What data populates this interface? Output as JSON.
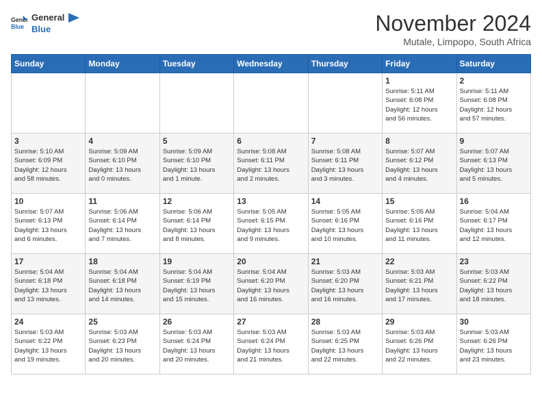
{
  "header": {
    "logo_general": "General",
    "logo_blue": "Blue",
    "month_title": "November 2024",
    "location": "Mutale, Limpopo, South Africa"
  },
  "days_of_week": [
    "Sunday",
    "Monday",
    "Tuesday",
    "Wednesday",
    "Thursday",
    "Friday",
    "Saturday"
  ],
  "weeks": [
    {
      "days": [
        {
          "number": "",
          "info": ""
        },
        {
          "number": "",
          "info": ""
        },
        {
          "number": "",
          "info": ""
        },
        {
          "number": "",
          "info": ""
        },
        {
          "number": "",
          "info": ""
        },
        {
          "number": "1",
          "info": "Sunrise: 5:11 AM\nSunset: 6:08 PM\nDaylight: 12 hours\nand 56 minutes."
        },
        {
          "number": "2",
          "info": "Sunrise: 5:11 AM\nSunset: 6:08 PM\nDaylight: 12 hours\nand 57 minutes."
        }
      ]
    },
    {
      "days": [
        {
          "number": "3",
          "info": "Sunrise: 5:10 AM\nSunset: 6:09 PM\nDaylight: 12 hours\nand 58 minutes."
        },
        {
          "number": "4",
          "info": "Sunrise: 5:09 AM\nSunset: 6:10 PM\nDaylight: 13 hours\nand 0 minutes."
        },
        {
          "number": "5",
          "info": "Sunrise: 5:09 AM\nSunset: 6:10 PM\nDaylight: 13 hours\nand 1 minute."
        },
        {
          "number": "6",
          "info": "Sunrise: 5:08 AM\nSunset: 6:11 PM\nDaylight: 13 hours\nand 2 minutes."
        },
        {
          "number": "7",
          "info": "Sunrise: 5:08 AM\nSunset: 6:11 PM\nDaylight: 13 hours\nand 3 minutes."
        },
        {
          "number": "8",
          "info": "Sunrise: 5:07 AM\nSunset: 6:12 PM\nDaylight: 13 hours\nand 4 minutes."
        },
        {
          "number": "9",
          "info": "Sunrise: 5:07 AM\nSunset: 6:13 PM\nDaylight: 13 hours\nand 5 minutes."
        }
      ]
    },
    {
      "days": [
        {
          "number": "10",
          "info": "Sunrise: 5:07 AM\nSunset: 6:13 PM\nDaylight: 13 hours\nand 6 minutes."
        },
        {
          "number": "11",
          "info": "Sunrise: 5:06 AM\nSunset: 6:14 PM\nDaylight: 13 hours\nand 7 minutes."
        },
        {
          "number": "12",
          "info": "Sunrise: 5:06 AM\nSunset: 6:14 PM\nDaylight: 13 hours\nand 8 minutes."
        },
        {
          "number": "13",
          "info": "Sunrise: 5:05 AM\nSunset: 6:15 PM\nDaylight: 13 hours\nand 9 minutes."
        },
        {
          "number": "14",
          "info": "Sunrise: 5:05 AM\nSunset: 6:16 PM\nDaylight: 13 hours\nand 10 minutes."
        },
        {
          "number": "15",
          "info": "Sunrise: 5:05 AM\nSunset: 6:16 PM\nDaylight: 13 hours\nand 11 minutes."
        },
        {
          "number": "16",
          "info": "Sunrise: 5:04 AM\nSunset: 6:17 PM\nDaylight: 13 hours\nand 12 minutes."
        }
      ]
    },
    {
      "days": [
        {
          "number": "17",
          "info": "Sunrise: 5:04 AM\nSunset: 6:18 PM\nDaylight: 13 hours\nand 13 minutes."
        },
        {
          "number": "18",
          "info": "Sunrise: 5:04 AM\nSunset: 6:18 PM\nDaylight: 13 hours\nand 14 minutes."
        },
        {
          "number": "19",
          "info": "Sunrise: 5:04 AM\nSunset: 6:19 PM\nDaylight: 13 hours\nand 15 minutes."
        },
        {
          "number": "20",
          "info": "Sunrise: 5:04 AM\nSunset: 6:20 PM\nDaylight: 13 hours\nand 16 minutes."
        },
        {
          "number": "21",
          "info": "Sunrise: 5:03 AM\nSunset: 6:20 PM\nDaylight: 13 hours\nand 16 minutes."
        },
        {
          "number": "22",
          "info": "Sunrise: 5:03 AM\nSunset: 6:21 PM\nDaylight: 13 hours\nand 17 minutes."
        },
        {
          "number": "23",
          "info": "Sunrise: 5:03 AM\nSunset: 6:22 PM\nDaylight: 13 hours\nand 18 minutes."
        }
      ]
    },
    {
      "days": [
        {
          "number": "24",
          "info": "Sunrise: 5:03 AM\nSunset: 6:22 PM\nDaylight: 13 hours\nand 19 minutes."
        },
        {
          "number": "25",
          "info": "Sunrise: 5:03 AM\nSunset: 6:23 PM\nDaylight: 13 hours\nand 20 minutes."
        },
        {
          "number": "26",
          "info": "Sunrise: 5:03 AM\nSunset: 6:24 PM\nDaylight: 13 hours\nand 20 minutes."
        },
        {
          "number": "27",
          "info": "Sunrise: 5:03 AM\nSunset: 6:24 PM\nDaylight: 13 hours\nand 21 minutes."
        },
        {
          "number": "28",
          "info": "Sunrise: 5:03 AM\nSunset: 6:25 PM\nDaylight: 13 hours\nand 22 minutes."
        },
        {
          "number": "29",
          "info": "Sunrise: 5:03 AM\nSunset: 6:26 PM\nDaylight: 13 hours\nand 22 minutes."
        },
        {
          "number": "30",
          "info": "Sunrise: 5:03 AM\nSunset: 6:26 PM\nDaylight: 13 hours\nand 23 minutes."
        }
      ]
    }
  ]
}
